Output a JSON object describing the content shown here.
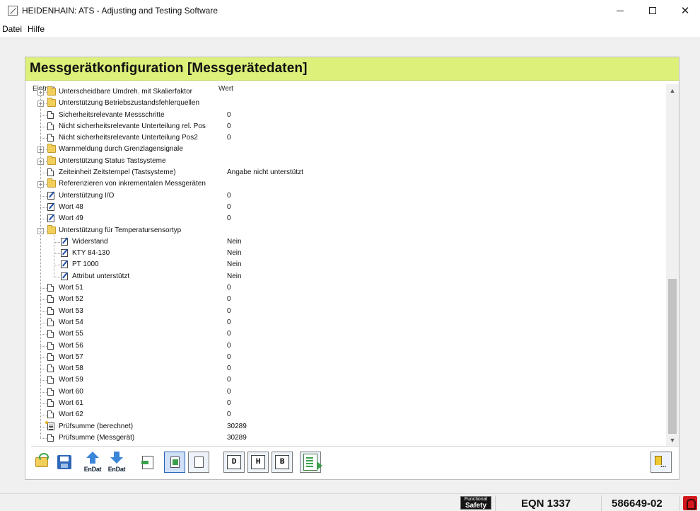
{
  "window": {
    "title": "HEIDENHAIN: ATS - Adjusting and Testing Software",
    "minimize": "–",
    "maximize": "□",
    "close": "✕"
  },
  "menu": [
    "Datei",
    "Hilfe"
  ],
  "panel": {
    "title": "Messgerätkonfiguration [Messgerätedaten]",
    "columns": {
      "entry": "Eintrag",
      "value": "Wert"
    }
  },
  "rows": [
    {
      "label": "Unterscheidbare Umdreh. mit Skalierfaktor",
      "value": "",
      "icon": "folder-icon",
      "level": 1,
      "expandable": true
    },
    {
      "label": "Unterstützung Betriebszustandsfehlerquellen",
      "value": "",
      "icon": "folder-icon",
      "level": 1,
      "expandable": true
    },
    {
      "label": "Sicherheitsrelevante Messschritte",
      "value": "0",
      "icon": "document-icon",
      "level": 1,
      "expandable": false
    },
    {
      "label": "Nicht sicherheitsrelevante Unterteilung rel. Pos",
      "value": "0",
      "icon": "document-icon",
      "level": 1,
      "expandable": false
    },
    {
      "label": "Nicht sicherheitsrelevante Unterteilung Pos2",
      "value": "0",
      "icon": "document-icon",
      "level": 1,
      "expandable": false
    },
    {
      "label": "Warnmeldung durch Grenzlagensignale",
      "value": "",
      "icon": "folder-icon",
      "level": 1,
      "expandable": true
    },
    {
      "label": "Unterstützung Status Tastsysteme",
      "value": "",
      "icon": "folder-icon",
      "level": 1,
      "expandable": true
    },
    {
      "label": "Zeiteinheit Zeitstempel (Tastsysteme)",
      "value": "Angabe nicht unterstützt",
      "icon": "document-icon",
      "level": 1,
      "expandable": false
    },
    {
      "label": "Referenzieren von inkrementalen Messgeräten",
      "value": "",
      "icon": "folder-icon",
      "level": 1,
      "expandable": true
    },
    {
      "label": "Unterstützung I/O",
      "value": "0",
      "icon": "edit-document-icon",
      "level": 1,
      "expandable": false
    },
    {
      "label": "Wort 48",
      "value": "0",
      "icon": "edit-document-icon",
      "level": 1,
      "expandable": false
    },
    {
      "label": "Wort 49",
      "value": "0",
      "icon": "edit-document-icon",
      "level": 1,
      "expandable": false
    },
    {
      "label": "Unterstützung für Temperatursensortyp",
      "value": "",
      "icon": "folder-open-icon",
      "level": 1,
      "expandable": true,
      "expanded": true
    },
    {
      "label": "Widerstand",
      "value": "Nein",
      "icon": "edit-document-icon",
      "level": 2,
      "expandable": false
    },
    {
      "label": "KTY 84-130",
      "value": "Nein",
      "icon": "edit-document-icon",
      "level": 2,
      "expandable": false
    },
    {
      "label": "PT 1000",
      "value": "Nein",
      "icon": "edit-document-icon",
      "level": 2,
      "expandable": false
    },
    {
      "label": "Attribut unterstützt",
      "value": "Nein",
      "icon": "edit-document-icon",
      "level": 2,
      "expandable": false
    },
    {
      "label": "Wort 51",
      "value": "0",
      "icon": "document-icon",
      "level": 1,
      "expandable": false
    },
    {
      "label": "Wort 52",
      "value": "0",
      "icon": "document-icon",
      "level": 1,
      "expandable": false
    },
    {
      "label": "Wort 53",
      "value": "0",
      "icon": "document-icon",
      "level": 1,
      "expandable": false
    },
    {
      "label": "Wort 54",
      "value": "0",
      "icon": "document-icon",
      "level": 1,
      "expandable": false
    },
    {
      "label": "Wort 55",
      "value": "0",
      "icon": "document-icon",
      "level": 1,
      "expandable": false
    },
    {
      "label": "Wort 56",
      "value": "0",
      "icon": "document-icon",
      "level": 1,
      "expandable": false
    },
    {
      "label": "Wort 57",
      "value": "0",
      "icon": "document-icon",
      "level": 1,
      "expandable": false
    },
    {
      "label": "Wort 58",
      "value": "0",
      "icon": "document-icon",
      "level": 1,
      "expandable": false
    },
    {
      "label": "Wort 59",
      "value": "0",
      "icon": "document-icon",
      "level": 1,
      "expandable": false
    },
    {
      "label": "Wort 60",
      "value": "0",
      "icon": "document-icon",
      "level": 1,
      "expandable": false
    },
    {
      "label": "Wort 61",
      "value": "0",
      "icon": "document-icon",
      "level": 1,
      "expandable": false
    },
    {
      "label": "Wort 62",
      "value": "0",
      "icon": "document-icon",
      "level": 1,
      "expandable": false
    },
    {
      "label": "Prüfsumme (berechnet)",
      "value": "30289",
      "icon": "calculated-document-icon",
      "level": 1,
      "expandable": false
    },
    {
      "label": "Prüfsumme (Messgerät)",
      "value": "30289",
      "icon": "document-icon",
      "level": 1,
      "expandable": false
    }
  ],
  "toolbar": {
    "endat_upload_label": "EnDat",
    "endat_download_label": "EnDat",
    "decimal_label": "D",
    "hex_label": "H",
    "binary_label": "B"
  },
  "statusbar": {
    "functional_safety_top": "Functional",
    "functional_safety_bottom": "Safety",
    "device_model": "EQN 1337",
    "device_id": "586649-02"
  },
  "colors": {
    "header_bg": "#dcf07a",
    "status_led": "#d3171b"
  }
}
